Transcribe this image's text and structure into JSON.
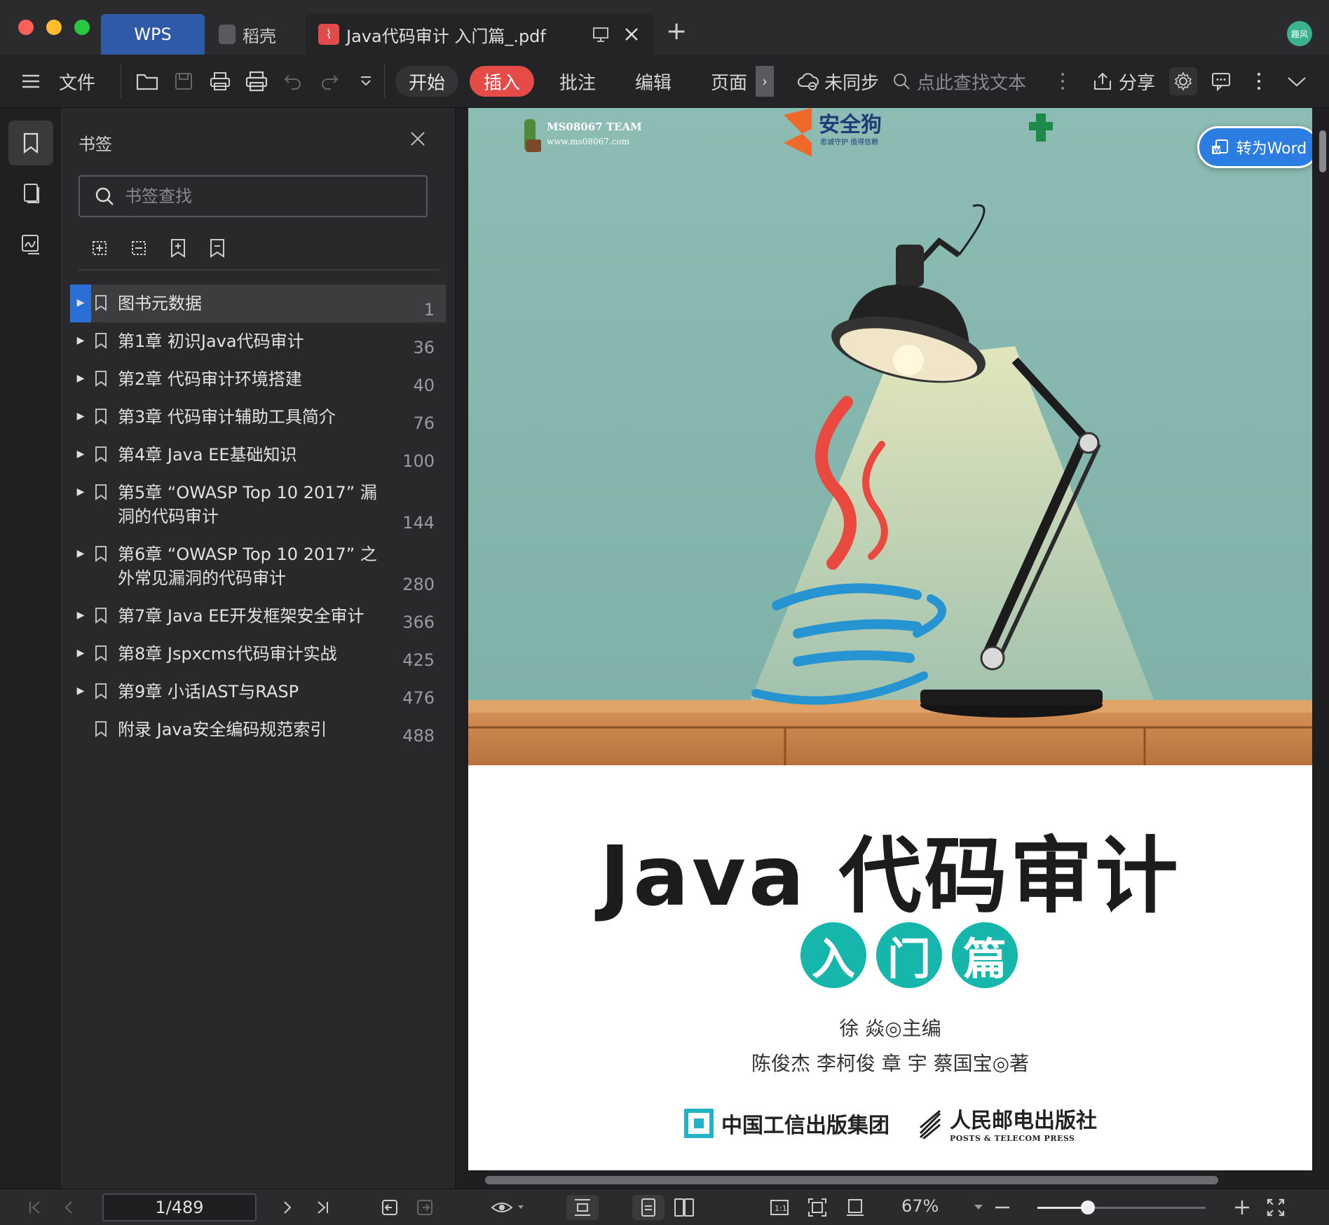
{
  "tabs": {
    "wps": "WPS",
    "daoke": "稻壳",
    "document": "Java代码审计 入门篇_.pdf",
    "add": "+"
  },
  "avatar_label": "趣风",
  "toolbar": {
    "file": "文件",
    "start": "开始",
    "insert": "插入",
    "annotate": "批注",
    "edit": "编辑",
    "page": "页面",
    "sync": "未同步",
    "search_placeholder": "点此查找文本",
    "share": "分享"
  },
  "bookmarks": {
    "title": "书签",
    "search_placeholder": "书签查找",
    "items": [
      {
        "label": "图书元数据",
        "page": "1",
        "has_children": true,
        "selected": true
      },
      {
        "label": "第1章 初识Java代码审计",
        "page": "36",
        "has_children": true
      },
      {
        "label": "第2章 代码审计环境搭建",
        "page": "40",
        "has_children": true
      },
      {
        "label": "第3章 代码审计辅助工具简介",
        "page": "76",
        "has_children": true
      },
      {
        "label": "第4章 Java EE基础知识",
        "page": "100",
        "has_children": true
      },
      {
        "label": "第5章 “OWASP Top 10 2017” 漏洞的代码审计",
        "page": "144",
        "has_children": true
      },
      {
        "label": "第6章 “OWASP Top 10 2017” 之外常见漏洞的代码审计",
        "page": "280",
        "has_children": true
      },
      {
        "label": "第7章 Java EE开发框架安全审计",
        "page": "366",
        "has_children": true
      },
      {
        "label": "第8章 Jspxcms代码审计实战",
        "page": "425",
        "has_children": true
      },
      {
        "label": "第9章 小话IAST与RASP",
        "page": "476",
        "has_children": true
      },
      {
        "label": "附录 Java安全编码规范索引",
        "page": "488",
        "has_children": false
      }
    ]
  },
  "document": {
    "to_word": "转为Word",
    "cover": {
      "team_name": "MS08067 TEAM",
      "team_url": "www.ms08067.com",
      "sponsor": "安全狗",
      "sponsor_tagline": "忠诚守护 值得信赖",
      "title": "Java 代码审计",
      "subtitle_chars": [
        "入",
        "门",
        "篇"
      ],
      "editor": "徐 焱◎主编",
      "authors": "陈俊杰 李柯俊 章 宇 蔡国宝◎著",
      "publisher1": "中国工信出版集团",
      "publisher2": "人民邮电出版社",
      "publisher2_en": "POSTS & TELECOM PRESS"
    }
  },
  "statusbar": {
    "page_indicator": "1/489",
    "zoom": "67%",
    "zoom_level": 0.3
  },
  "colors": {
    "accent_insert": "#e54b47",
    "wps_tab": "#2f5aa8",
    "selection": "#2a6fd6",
    "cover_teal": "#16b6ad",
    "to_word": "#2b7de1"
  }
}
